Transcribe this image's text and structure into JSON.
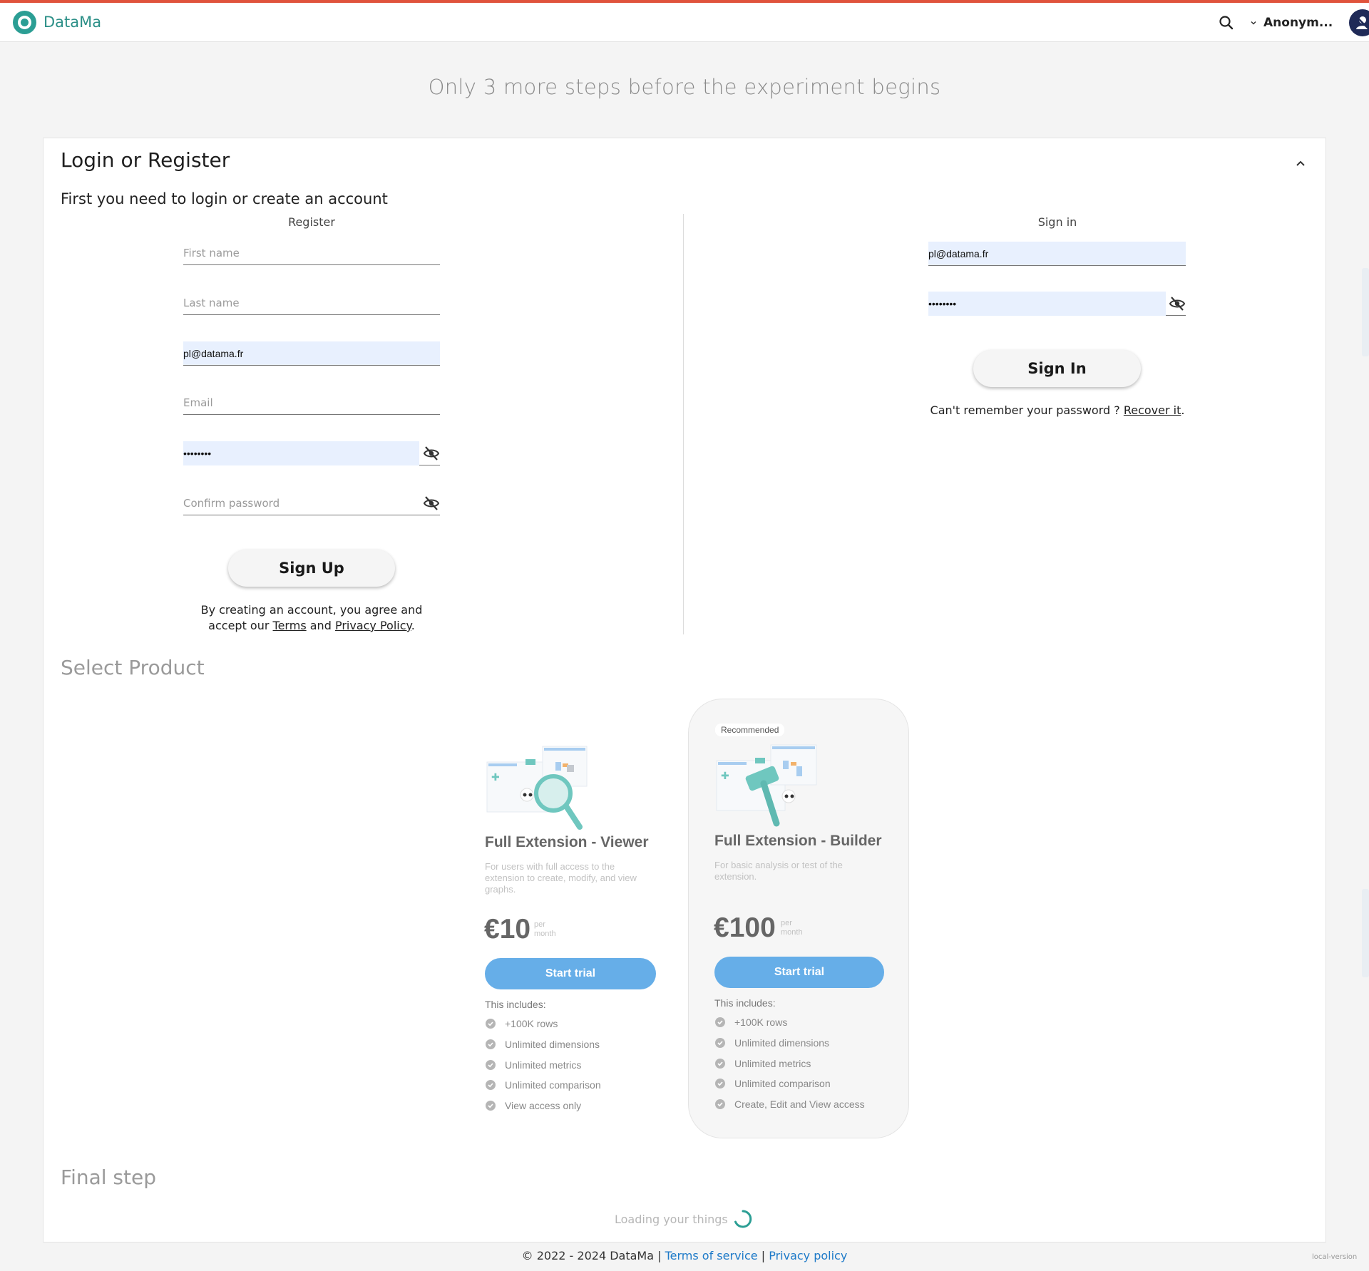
{
  "app": {
    "name": "DataMa"
  },
  "header": {
    "search_icon": "search-icon",
    "user_name": "Anonym...",
    "avatar_icon": "user-avatar-icon"
  },
  "page": {
    "heading": "Only 3 more steps before the experiment begins"
  },
  "login_section": {
    "title": "Login or Register",
    "subtitle": "First you need to login or create an account",
    "register": {
      "title": "Register",
      "first_name_placeholder": "First name",
      "last_name_placeholder": "Last name",
      "username_value": "pl@datama.fr",
      "email_placeholder": "Email",
      "password_value": "••••••••",
      "confirm_password_placeholder": "Confirm password",
      "submit_label": "Sign Up",
      "agree_text_1": "By creating an account, you agree and",
      "agree_text_2": "accept our",
      "terms_label": "Terms",
      "and_text": "and",
      "privacy_label": "Privacy Policy",
      "end_dot": "."
    },
    "signin": {
      "title": "Sign in",
      "email_value": "pl@datama.fr",
      "password_value": "••••••••",
      "submit_label": "Sign In",
      "recover_text": "Can't remember your password ?",
      "recover_label": "Recover it",
      "end_dot": "."
    }
  },
  "products_section": {
    "title": "Select Product",
    "products": [
      {
        "name": "Full Extension - Viewer",
        "description": "For users with full access to the extension to create, modify, and view graphs.",
        "price": "€10",
        "per_1": "per",
        "per_2": "month",
        "button": "Start trial",
        "includes_label": "This includes:",
        "features": [
          "+100K rows",
          "Unlimited dimensions",
          "Unlimited metrics",
          "Unlimited comparison",
          "View access only"
        ],
        "illustration": "magnifier-illustration"
      },
      {
        "badge": "Recommended",
        "name": "Full Extension - Builder",
        "description": "For basic analysis or test of the extension.",
        "price": "€100",
        "per_1": "per",
        "per_2": "month",
        "button": "Start trial",
        "includes_label": "This includes:",
        "features": [
          "+100K rows",
          "Unlimited dimensions",
          "Unlimited metrics",
          "Unlimited comparison",
          "Create, Edit and View access"
        ],
        "illustration": "hammer-illustration"
      }
    ]
  },
  "final_section": {
    "title": "Final step",
    "loading_text": "Loading your things"
  },
  "footer": {
    "copyright": "© 2022 - 2024 DataMa |",
    "terms_label": "Terms of service",
    "separator": "|",
    "privacy_label": "Privacy policy",
    "version": "local-version"
  },
  "colors": {
    "accent_top_line": "#e0533c",
    "brand_teal": "#2b9e94",
    "trial_button": "#66aee8",
    "autofill_bg": "#e8f0fe",
    "footer_link": "#1e7ac8"
  }
}
